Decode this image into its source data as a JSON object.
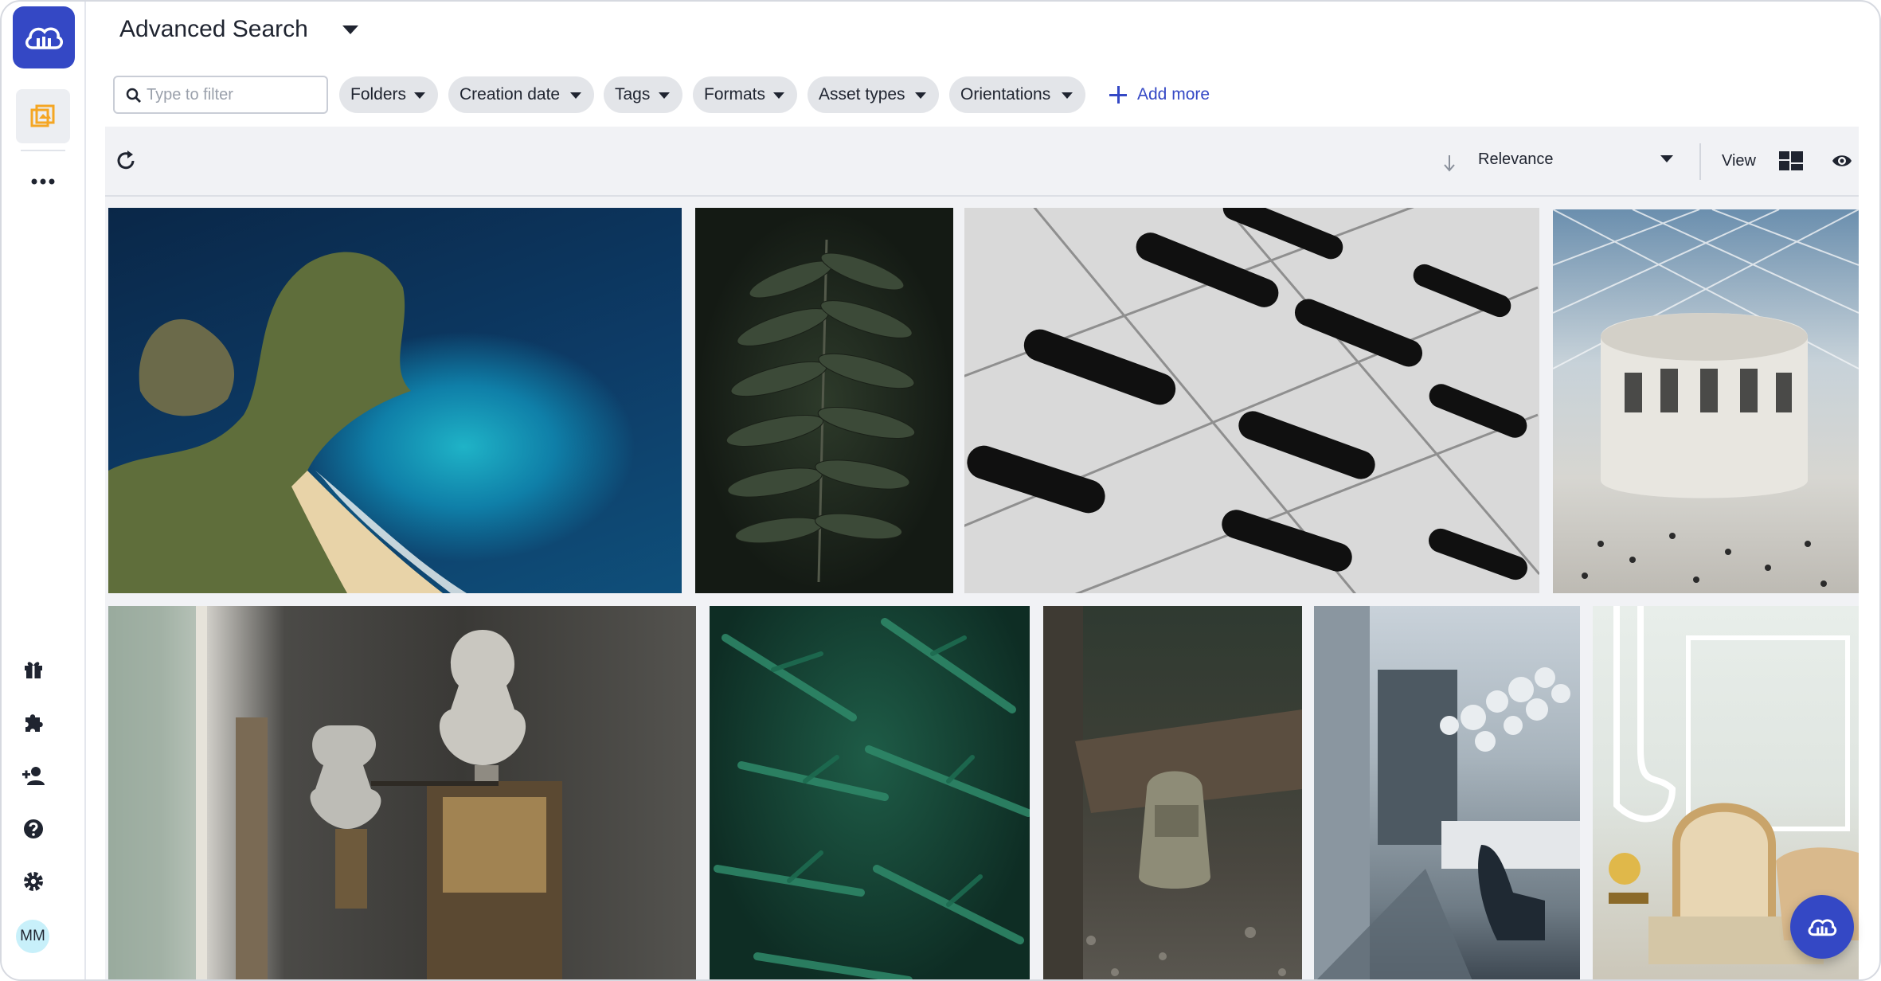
{
  "header": {
    "title": "Advanced Search"
  },
  "filter": {
    "placeholder": "Type to filter",
    "value": ""
  },
  "chips": [
    {
      "label": "Folders"
    },
    {
      "label": "Creation date"
    },
    {
      "label": "Tags"
    },
    {
      "label": "Formats"
    },
    {
      "label": "Asset types"
    },
    {
      "label": "Orientations"
    }
  ],
  "add_more_label": "Add more",
  "toolbar": {
    "sort_label": "Relevance",
    "view_label": "View"
  },
  "user": {
    "initials": "MM"
  },
  "colors": {
    "brand": "#3448c5",
    "chip_bg": "#e3e5e9",
    "toolbar_bg": "#f1f2f5",
    "accent_orange": "#f5a623"
  },
  "rail_icons": [
    "cloud-logo-icon",
    "media-library-icon",
    "more-icon",
    "gift-icon",
    "puzzle-icon",
    "add-user-icon",
    "help-icon",
    "gear-icon"
  ],
  "assets": [
    {
      "subject": "coastal-cliff"
    },
    {
      "subject": "fern-leaf"
    },
    {
      "subject": "concrete-facade"
    },
    {
      "subject": "museum-atrium"
    },
    {
      "subject": "sculpture-studio"
    },
    {
      "subject": "green-ferns"
    },
    {
      "subject": "backpack-forest"
    },
    {
      "subject": "modern-lobby"
    },
    {
      "subject": "classic-chair"
    }
  ]
}
